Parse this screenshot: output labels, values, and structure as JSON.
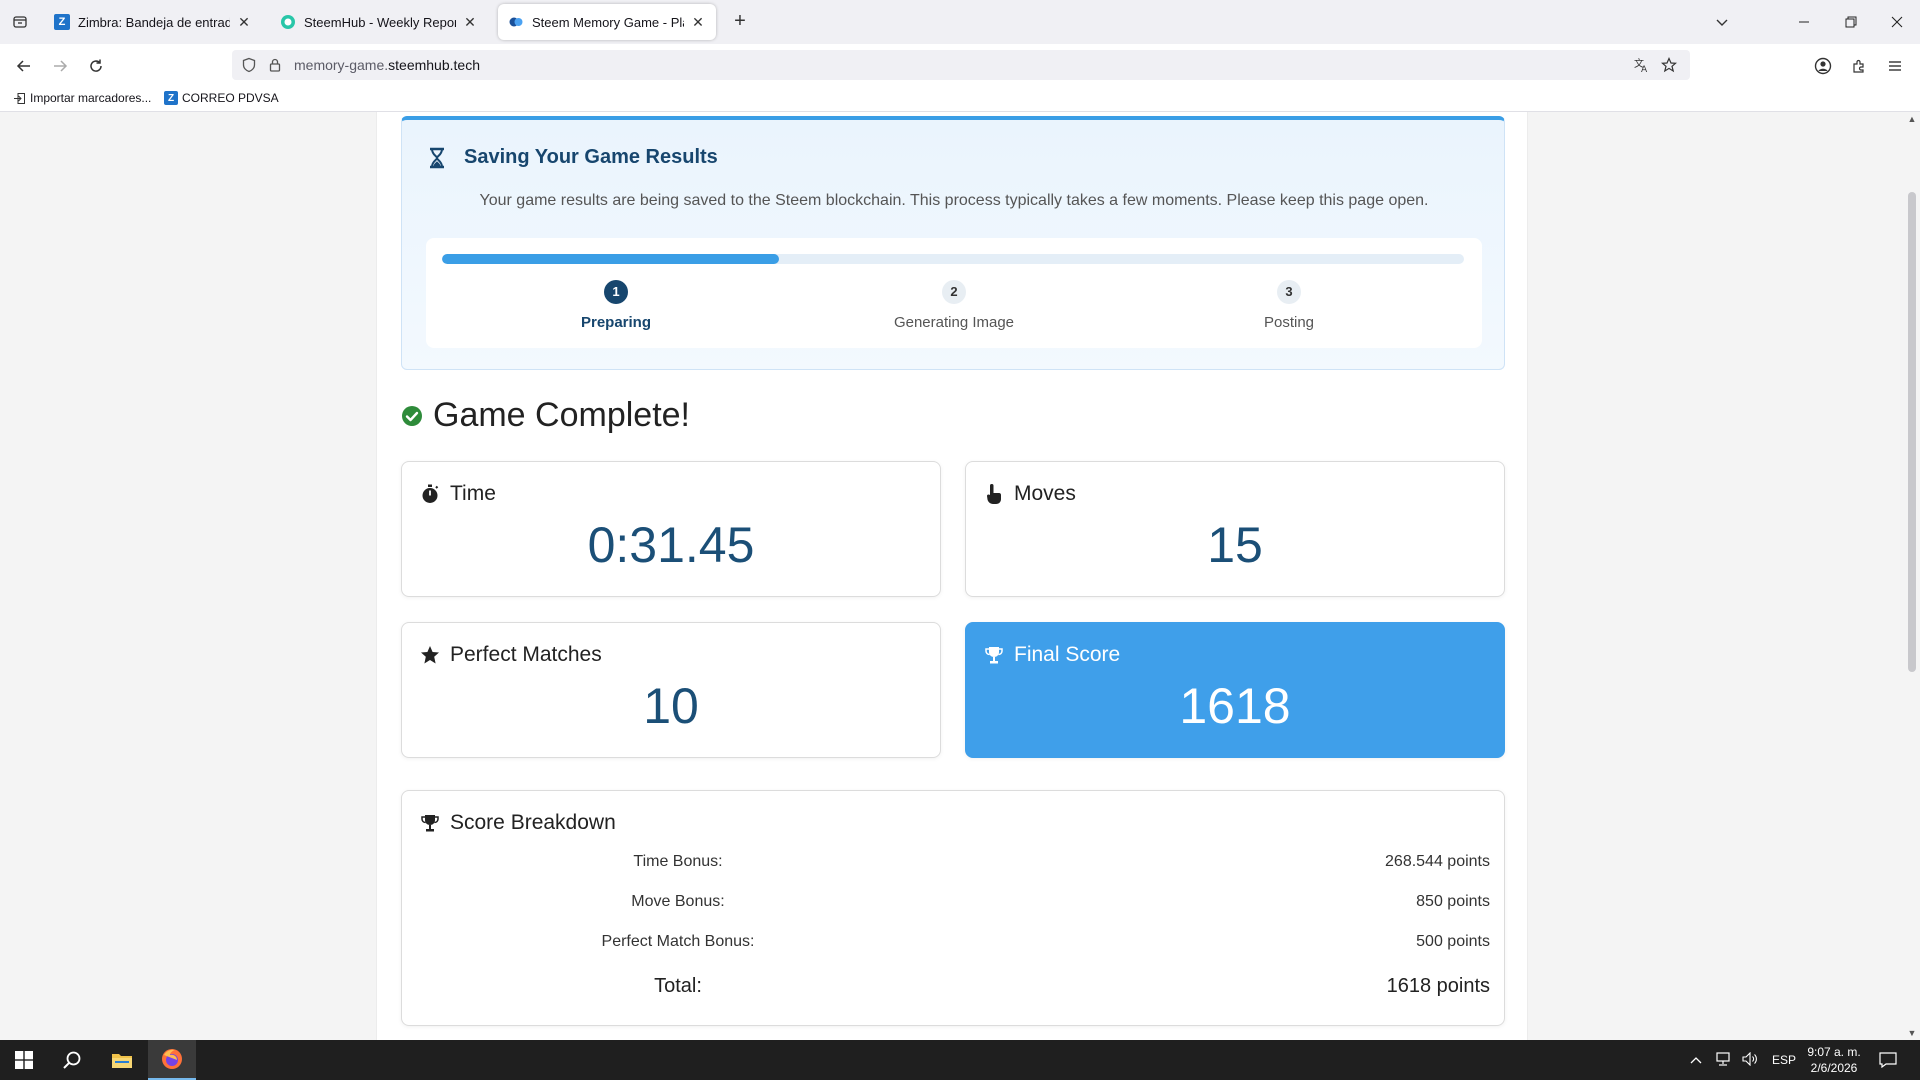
{
  "browser": {
    "tabs": [
      {
        "title": "Zimbra: Bandeja de entrada",
        "favicon": "zimbra-logo-icon",
        "active": false
      },
      {
        "title": "SteemHub - Weekly Report - W",
        "favicon": "steemhub-logo-icon",
        "active": false
      },
      {
        "title": "Steem Memory Game - Play an",
        "favicon": "steem-logo-icon",
        "active": true
      }
    ],
    "url_prefix": "memory-game.",
    "url_domain": "steemhub.tech",
    "bookmarks": [
      {
        "label": "Importar marcadores...",
        "icon": "import-icon"
      },
      {
        "label": "CORREO PDVSA",
        "icon": "zimbra-logo-icon"
      }
    ]
  },
  "saving": {
    "title": "Saving Your Game Results",
    "description": "Your game results are being saved to the Steem blockchain. This process typically takes a few moments. Please keep this page open.",
    "progress_percent": 33,
    "steps": [
      {
        "number": "1",
        "label": "Preparing",
        "active": true
      },
      {
        "number": "2",
        "label": "Generating Image",
        "active": false
      },
      {
        "number": "3",
        "label": "Posting",
        "active": false
      }
    ]
  },
  "result": {
    "title": "Game Complete!",
    "stats": {
      "time": {
        "label": "Time",
        "value": "0:31.45",
        "icon": "stopwatch-icon"
      },
      "moves": {
        "label": "Moves",
        "value": "15",
        "icon": "pointer-hand-icon"
      },
      "perfect": {
        "label": "Perfect Matches",
        "value": "10",
        "icon": "star-icon"
      },
      "score": {
        "label": "Final Score",
        "value": "1618",
        "icon": "trophy-icon"
      }
    }
  },
  "breakdown": {
    "title": "Score Breakdown",
    "rows": [
      {
        "label": "Time Bonus:",
        "value": "268.544 points"
      },
      {
        "label": "Move Bonus:",
        "value": "850 points"
      },
      {
        "label": "Perfect Match Bonus:",
        "value": "500 points"
      }
    ],
    "total": {
      "label": "Total:",
      "value": "1618 points"
    }
  },
  "taskbar": {
    "language": "ESP",
    "time": "9:07 a. m.",
    "date": "2/6/2026"
  },
  "colors": {
    "accent": "#3a9ee6",
    "heading": "#17466e",
    "value": "#1b4f77",
    "success": "#2e8b3a"
  }
}
